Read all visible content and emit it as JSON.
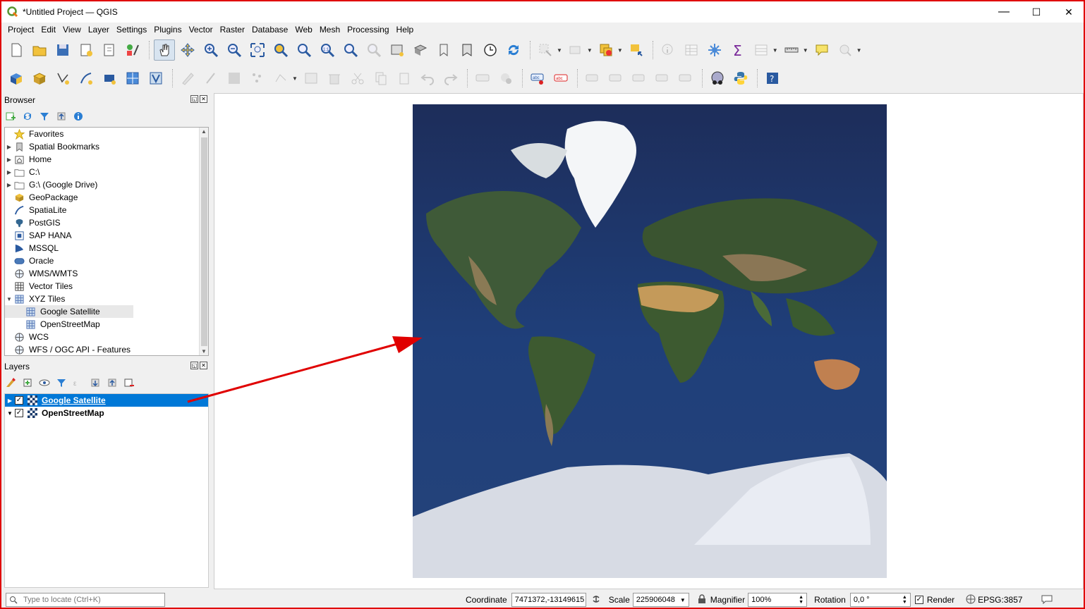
{
  "window": {
    "title": "*Untitled Project — QGIS",
    "minimize": "—",
    "maximize": "☐",
    "close": "✕"
  },
  "menubar": [
    "Project",
    "Edit",
    "View",
    "Layer",
    "Settings",
    "Plugins",
    "Vector",
    "Raster",
    "Database",
    "Web",
    "Mesh",
    "Processing",
    "Help"
  ],
  "browser": {
    "title": "Browser",
    "items": [
      {
        "label": "Favorites",
        "icon": "star-icon"
      },
      {
        "label": "Spatial Bookmarks",
        "icon": "bookmark-icon"
      },
      {
        "label": "Home",
        "icon": "home-folder-icon"
      },
      {
        "label": "C:\\",
        "icon": "folder-icon"
      },
      {
        "label": "G:\\ (Google Drive)",
        "icon": "folder-icon"
      },
      {
        "label": "GeoPackage",
        "icon": "geopackage-icon"
      },
      {
        "label": "SpatiaLite",
        "icon": "spatialite-icon"
      },
      {
        "label": "PostGIS",
        "icon": "postgis-elephant-icon"
      },
      {
        "label": "SAP HANA",
        "icon": "sap-hana-icon"
      },
      {
        "label": "MSSQL",
        "icon": "mssql-icon"
      },
      {
        "label": "Oracle",
        "icon": "oracle-icon"
      },
      {
        "label": "WMS/WMTS",
        "icon": "globe-icon"
      },
      {
        "label": "Vector Tiles",
        "icon": "vector-tiles-icon"
      },
      {
        "label": "XYZ Tiles",
        "icon": "xyz-tiles-icon"
      },
      {
        "label": "Google Satellite",
        "icon": "xyz-tiles-icon"
      },
      {
        "label": "OpenStreetMap",
        "icon": "xyz-tiles-icon"
      },
      {
        "label": "WCS",
        "icon": "globe-icon"
      },
      {
        "label": "WFS / OGC API - Features",
        "icon": "globe-icon"
      }
    ]
  },
  "layers": {
    "title": "Layers",
    "items": [
      {
        "label": "Google Satellite",
        "checked": "✓",
        "selected": true
      },
      {
        "label": "OpenStreetMap",
        "checked": "✓",
        "selected": false
      }
    ]
  },
  "statusbar": {
    "locate_placeholder": "Type to locate (Ctrl+K)",
    "coordinate_label": "Coordinate",
    "coordinate_value": "7471372,-13149615",
    "scale_label": "Scale",
    "scale_value": "225906048",
    "magnifier_label": "Magnifier",
    "magnifier_value": "100%",
    "rotation_label": "Rotation",
    "rotation_value": "0,0 °",
    "render_label": "Render",
    "crs": "EPSG:3857"
  },
  "colors": {
    "annotation_arrow": "#e00000",
    "selection": "#0078d7",
    "window_border": "#e00000"
  }
}
